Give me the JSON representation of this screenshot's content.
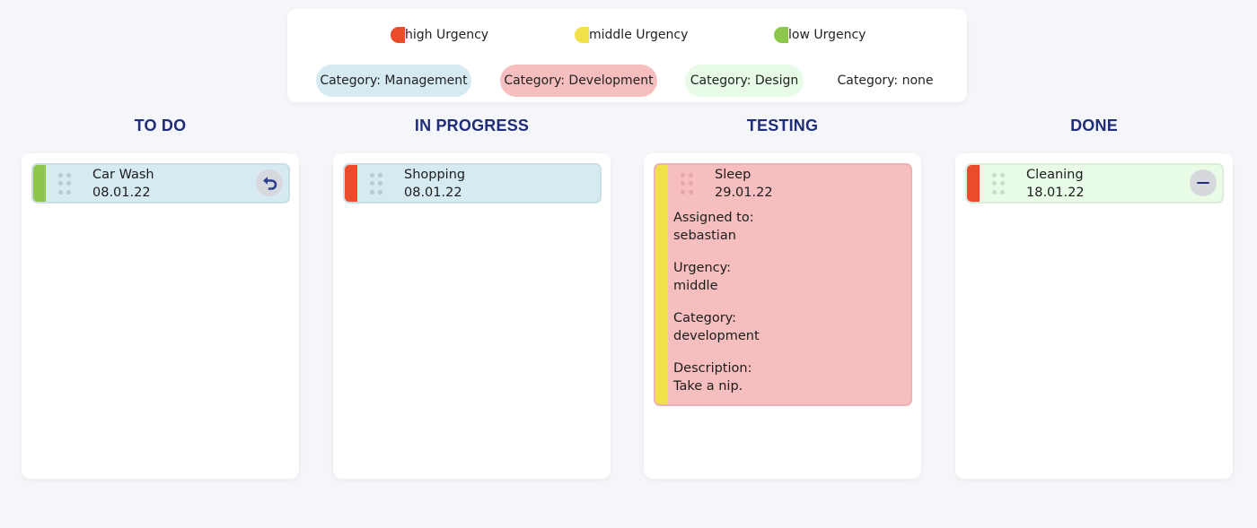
{
  "legend": {
    "urgency": [
      {
        "label": "high Urgency",
        "color": "#e94b2b"
      },
      {
        "label": "middle Urgency",
        "color": "#f2e04a"
      },
      {
        "label": "low Urgency",
        "color": "#8cc64a"
      }
    ],
    "categories": [
      {
        "label": "Category: Management",
        "color": "#d6eaf2"
      },
      {
        "label": "Category: Development",
        "color": "#f6bebf"
      },
      {
        "label": "Category: Design",
        "color": "#e7fbe6"
      },
      {
        "label": "Category: none",
        "color": "#ffffff"
      }
    ]
  },
  "columns": [
    {
      "title": "TO DO"
    },
    {
      "title": "IN PROGRESS"
    },
    {
      "title": "TESTING"
    },
    {
      "title": "DONE"
    }
  ],
  "cards": {
    "car_wash": {
      "title": "Car Wash",
      "date": "08.01.22",
      "urgency_color": "#8cc64a",
      "bg": "#d6eaf2",
      "action_icon": "undo-icon"
    },
    "shopping": {
      "title": "Shopping",
      "date": "08.01.22",
      "urgency_color": "#e94b2b",
      "bg": "#d6eaf2"
    },
    "sleep": {
      "title": "Sleep",
      "date": "29.01.22",
      "urgency_color": "#f2e04a",
      "bg": "#f6bebf",
      "assigned_label": "Assigned to:",
      "assigned_value": "sebastian",
      "urgency_label": "Urgency:",
      "urgency_value": "middle",
      "category_label": "Category:",
      "category_value": "development",
      "description_label": "Description:",
      "description_value": "Take a nip."
    },
    "cleaning": {
      "title": "Cleaning",
      "date": "18.01.22",
      "urgency_color": "#e94b2b",
      "bg": "#e7fbe6",
      "action_icon": "minus-icon"
    }
  },
  "colors": {
    "page_bg": "#f5f6f9",
    "column_title": "#1f2d7a",
    "undo_icon": "#2c3e8c",
    "minus_icon": "#1f2d7a"
  }
}
